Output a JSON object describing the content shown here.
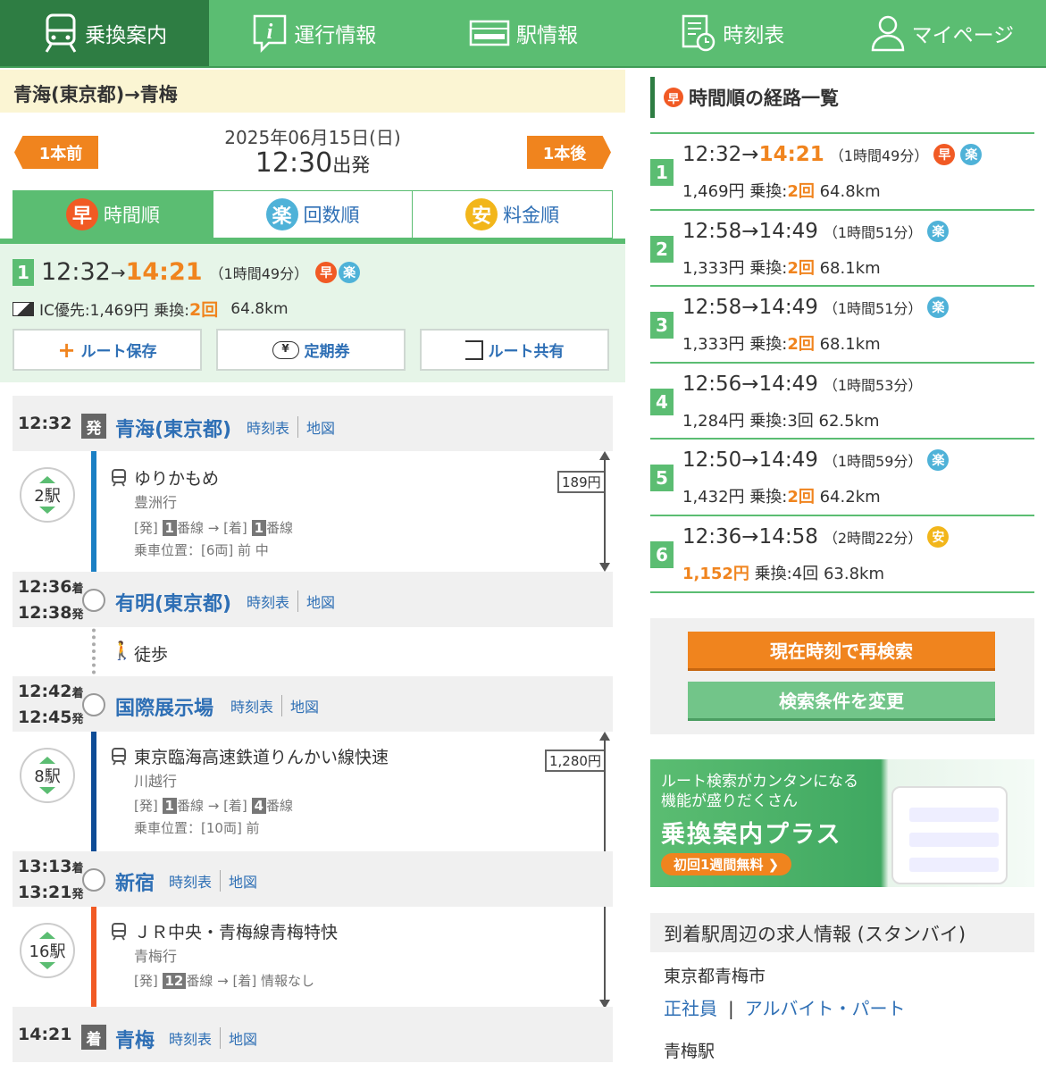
{
  "nav": {
    "items": [
      {
        "label": "乗換案内",
        "icon": "train-icon",
        "active": true
      },
      {
        "label": "運行情報",
        "icon": "info-icon"
      },
      {
        "label": "駅情報",
        "icon": "station-icon"
      },
      {
        "label": "時刻表",
        "icon": "timetable-icon"
      },
      {
        "label": "マイページ",
        "icon": "user-icon"
      }
    ]
  },
  "header": {
    "title": "青海(東京都)→青梅"
  },
  "search": {
    "date": "2025年06月15日(日)",
    "time": "12:30",
    "time_suffix": "出発",
    "prev": "1本前",
    "next": "1本後"
  },
  "tabs": [
    {
      "badge": "早",
      "label": "時間順",
      "active": true
    },
    {
      "badge": "楽",
      "label": "回数順"
    },
    {
      "badge": "安",
      "label": "料金順"
    }
  ],
  "summary": {
    "num": "1",
    "dep": "12:32",
    "arrow": "→",
    "arr": "14:21",
    "dur": "（1時間49分）",
    "badges": [
      "早",
      "楽"
    ],
    "ic_label": "IC優先:1,469円",
    "transfer_label": "乗換:",
    "transfer": "2回",
    "distance": "64.8km",
    "buttons": [
      "ルート保存",
      "定期券",
      "ルート共有"
    ]
  },
  "route": {
    "links": {
      "timetable": "時刻表",
      "map": "地図"
    },
    "stations": [
      {
        "arr": "",
        "dep": "12:32",
        "tag": "発",
        "name": "青海(東京都)"
      },
      {
        "arr": "12:36",
        "dep": "12:38",
        "name": "有明(東京都)"
      },
      {
        "arr": "12:42",
        "dep": "12:45",
        "name": "国際展示場"
      },
      {
        "arr": "13:13",
        "dep": "13:21",
        "name": "新宿"
      },
      {
        "arr": "14:21",
        "dep": "",
        "tag": "着",
        "name": "青梅"
      }
    ],
    "arr_suffix": "着",
    "dep_suffix": "発",
    "segments": [
      {
        "count": "2駅",
        "line": "ゆりかもめ",
        "dest": "豊洲行",
        "plat_from": "1",
        "plat_to": "1",
        "plat_suffix": "番線",
        "pos": "乗車位置：[6両] 前 中",
        "fare": "189円"
      },
      {
        "walk": "徒歩"
      },
      {
        "count": "8駅",
        "line": "東京臨海高速鉄道りんかい線快速",
        "dest": "川越行",
        "plat_from": "1",
        "plat_to": "4",
        "plat_suffix": "番線",
        "pos": "乗車位置：[10両] 前",
        "fare": "1,280円"
      },
      {
        "count": "16駅",
        "line": "ＪＲ中央・青梅線青梅特快",
        "dest": "青梅行",
        "plat_from": "12",
        "plat_to_text": "情報なし",
        "plat_suffix": "番線"
      }
    ],
    "plat_dep": "[発]",
    "plat_arr": "[着]"
  },
  "side": {
    "title": "時間順の経路一覧",
    "routes": [
      {
        "num": "1",
        "dep": "12:32",
        "arr": "14:21",
        "dur": "（1時間49分）",
        "badges": [
          "早",
          "楽"
        ],
        "fare": "1,469円",
        "transfer": "2回",
        "dist": "64.8km",
        "arr_hl": true,
        "tr_hl": true
      },
      {
        "num": "2",
        "dep": "12:58",
        "arr": "14:49",
        "dur": "（1時間51分）",
        "badges": [
          "楽"
        ],
        "fare": "1,333円",
        "transfer": "2回",
        "dist": "68.1km",
        "tr_hl": true
      },
      {
        "num": "3",
        "dep": "12:58",
        "arr": "14:49",
        "dur": "（1時間51分）",
        "badges": [
          "楽"
        ],
        "fare": "1,333円",
        "transfer": "2回",
        "dist": "68.1km",
        "tr_hl": true
      },
      {
        "num": "4",
        "dep": "12:56",
        "arr": "14:49",
        "dur": "（1時間53分）",
        "badges": [],
        "fare": "1,284円",
        "transfer": "3回",
        "dist": "62.5km"
      },
      {
        "num": "5",
        "dep": "12:50",
        "arr": "14:49",
        "dur": "（1時間59分）",
        "badges": [
          "楽"
        ],
        "fare": "1,432円",
        "transfer": "2回",
        "dist": "64.2km",
        "tr_hl": true
      },
      {
        "num": "6",
        "dep": "12:36",
        "arr": "14:58",
        "dur": "（2時間22分）",
        "badges": [
          "安"
        ],
        "fare": "1,152円",
        "transfer": "4回",
        "dist": "63.8km",
        "fare_hl": true
      }
    ],
    "transfer_label": "乗換:",
    "research": "現在時刻で再検索",
    "change": "検索条件を変更"
  },
  "ad": {
    "line1": "ルート検索がカンタンになる",
    "line2": "機能が盛りだくさん",
    "title": "乗換案内プラス",
    "cta": "初回1週間無料 ❯"
  },
  "jobs": {
    "title": "到着駅周辺の求人情報 (スタンバイ)",
    "city": "東京都青梅市",
    "link1": "正社員",
    "sep": "|",
    "link2": "アルバイト・パート",
    "station": "青梅駅"
  },
  "colors": {
    "green": "#5bbd72",
    "dark_green": "#2e7d43",
    "orange": "#f0841e",
    "blue": "#2e6fb5",
    "line_blue": "#1a7fc4",
    "line_navy": "#0e4c96",
    "line_orange": "#f15a24"
  }
}
